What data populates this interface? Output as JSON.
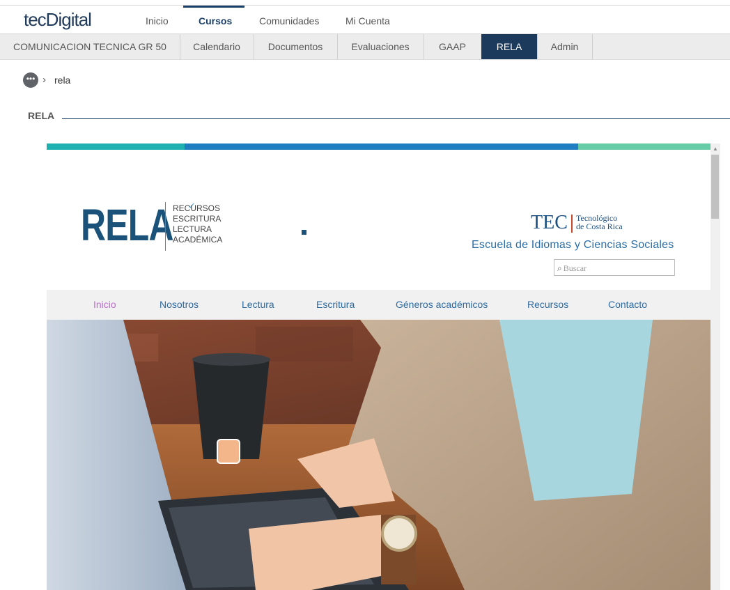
{
  "topnav": {
    "logo": "tecDigital",
    "items": [
      "Inicio",
      "Cursos",
      "Comunidades",
      "Mi Cuenta"
    ],
    "active": "Cursos"
  },
  "coursebar": {
    "course": "COMUNICACION TECNICA GR 50",
    "tabs": [
      "Calendario",
      "Documentos",
      "Evaluaciones",
      "GAAP",
      "RELA",
      "Admin"
    ],
    "active": "RELA"
  },
  "breadcrumb": {
    "current": "rela"
  },
  "section": {
    "title": "RELA"
  },
  "rela_site": {
    "logo_text": "RELA",
    "logo_words": [
      "RECURSOS",
      "ESCRITURA",
      "LECTURA",
      "ACADÉMICA"
    ],
    "tec_logo": "TEC",
    "tec_name_1": "Tecnológico",
    "tec_name_2": "de Costa Rica",
    "school": "Escuela de Idiomas y Ciencias Sociales",
    "search_placeholder": "Buscar",
    "menu": [
      "Inicio",
      "Nosotros",
      "Lectura",
      "Escritura",
      "Géneros académicos",
      "Recursos",
      "Contacto"
    ],
    "menu_active": "Inicio",
    "colors": {
      "bar_teal": "#1fb1b0",
      "bar_blue": "#1f7ec1",
      "bar_mint": "#66cca6",
      "brand_navy": "#1b5279"
    }
  }
}
